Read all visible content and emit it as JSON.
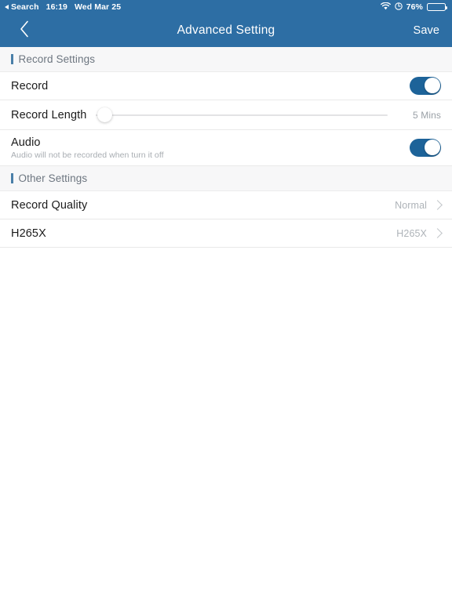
{
  "status_bar": {
    "back_app": "Search",
    "time": "16:19",
    "date": "Wed Mar 25",
    "battery_percent": "76%",
    "wifi_icon": "wifi-icon",
    "location_icon": "location-icon",
    "battery_icon": "battery-icon",
    "background_color": "#2d6ea4"
  },
  "nav_bar": {
    "back_icon": "chevron-left-icon",
    "title": "Advanced Setting",
    "save_label": "Save",
    "background_color": "#2d6ea4"
  },
  "sections": [
    {
      "title": "Record Settings",
      "accent_color": "#4a7fa8"
    },
    {
      "title": "Other Settings",
      "accent_color": "#4a7fa8"
    }
  ],
  "record_settings": {
    "record": {
      "label": "Record",
      "toggle_state": "on",
      "toggle_color": "#1d6399"
    },
    "record_length": {
      "label": "Record Length",
      "value": "5 Mins",
      "slider_position_percent": 3,
      "track_color": "#e3e3e5"
    },
    "audio": {
      "label": "Audio",
      "subtitle": "Audio will not be recorded when turn it off",
      "toggle_state": "on",
      "toggle_color": "#1d6399"
    }
  },
  "other_settings": {
    "record_quality": {
      "label": "Record Quality",
      "value": "Normal",
      "chevron_icon": "chevron-right-icon"
    },
    "h265x": {
      "label": "H265X",
      "value": "H265X",
      "chevron_icon": "chevron-right-icon"
    }
  }
}
